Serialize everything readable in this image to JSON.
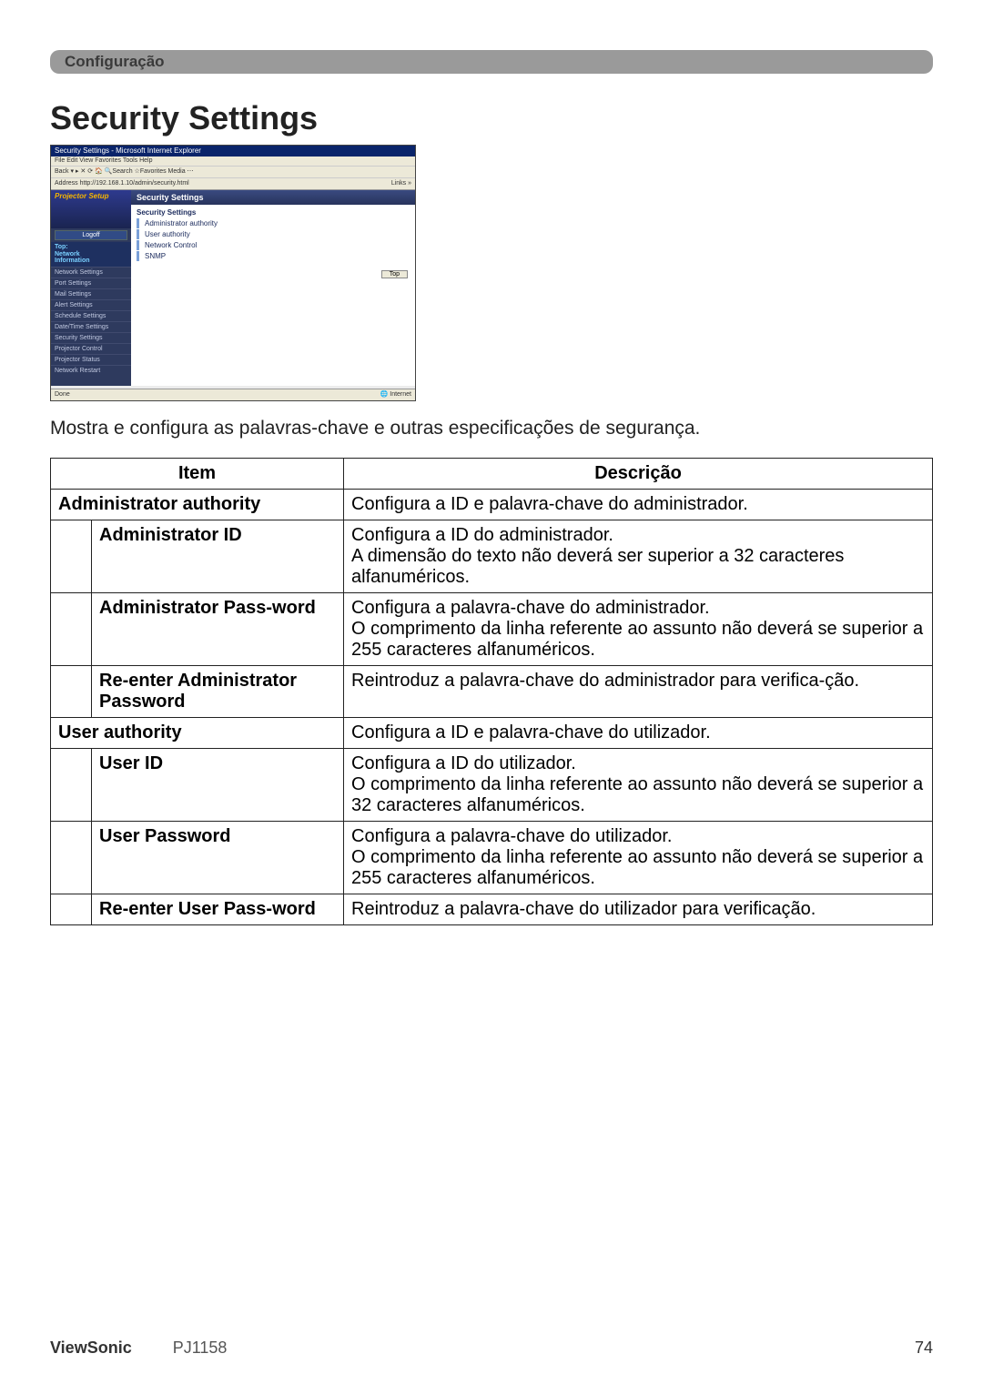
{
  "header": {
    "section": "Configuração"
  },
  "title": "Security Settings",
  "screenshot": {
    "window_title": "Security Settings - Microsoft Internet Explorer",
    "menu": "File  Edit  View  Favorites  Tools  Help",
    "toolbar": "Back  ▾  ▸   ✕  ⟳  🏠   🔍Search  ☆Favorites  Media  ⋯",
    "address": "Address  http://192.168.1.10/admin/security.html",
    "links_label": "Links »",
    "sidebar": {
      "brand": "Projector Setup",
      "logoff": "Logoff",
      "section_top": "Top:\nNetwork\nInformation",
      "items": [
        "Network Settings",
        "Port Settings",
        "Mail Settings",
        "Alert Settings",
        "Schedule Settings",
        "Date/Time Settings",
        "Security Settings",
        "Projector Control",
        "Projector Status",
        "Network Restart"
      ]
    },
    "main": {
      "header": "Security Settings",
      "subheading": "Security Settings",
      "list": [
        "Administrator authority",
        "User authority",
        "Network Control",
        "SNMP"
      ],
      "top_btn": "Top"
    },
    "status_left": "Done",
    "status_right": "🌐 Internet"
  },
  "intro": "Mostra e configura as palavras-chave e outras especificações de segurança.",
  "table": {
    "head_item": "Item",
    "head_desc": "Descrição",
    "rows": [
      {
        "type": "top",
        "item": "Administrator authority",
        "desc": "Configura a ID e palavra-chave do administrador."
      },
      {
        "type": "sub",
        "item": "Administrator ID",
        "desc": "Configura a ID do administrador.\nA dimensão do texto não deverá ser superior a 32 caracteres alfanuméricos."
      },
      {
        "type": "sub",
        "item": "Administrator Pass-word",
        "desc": "Configura a palavra-chave do administrador.\nO comprimento da linha referente ao assunto não deverá se superior a 255 caracteres alfanuméricos."
      },
      {
        "type": "sub",
        "item": "Re-enter Administrator Password",
        "desc": "Reintroduz a palavra-chave do administrador para verifica-ção."
      },
      {
        "type": "top",
        "item": "User authority",
        "desc": "Configura a ID e palavra-chave do utilizador."
      },
      {
        "type": "sub",
        "item": "User ID",
        "desc": "Configura a ID do utilizador.\nO comprimento da linha referente ao assunto não deverá se superior a 32 caracteres alfanuméricos."
      },
      {
        "type": "sub",
        "item": "User Password",
        "desc": "Configura a palavra-chave do utilizador.\nO comprimento da linha referente ao assunto não deverá se superior a 255 caracteres alfanuméricos."
      },
      {
        "type": "sub",
        "item": "Re-enter User Pass-word",
        "desc": "Reintroduz a palavra-chave do utilizador para verificação."
      }
    ]
  },
  "footer": {
    "brand": "ViewSonic",
    "model": "PJ1158",
    "page": "74"
  }
}
